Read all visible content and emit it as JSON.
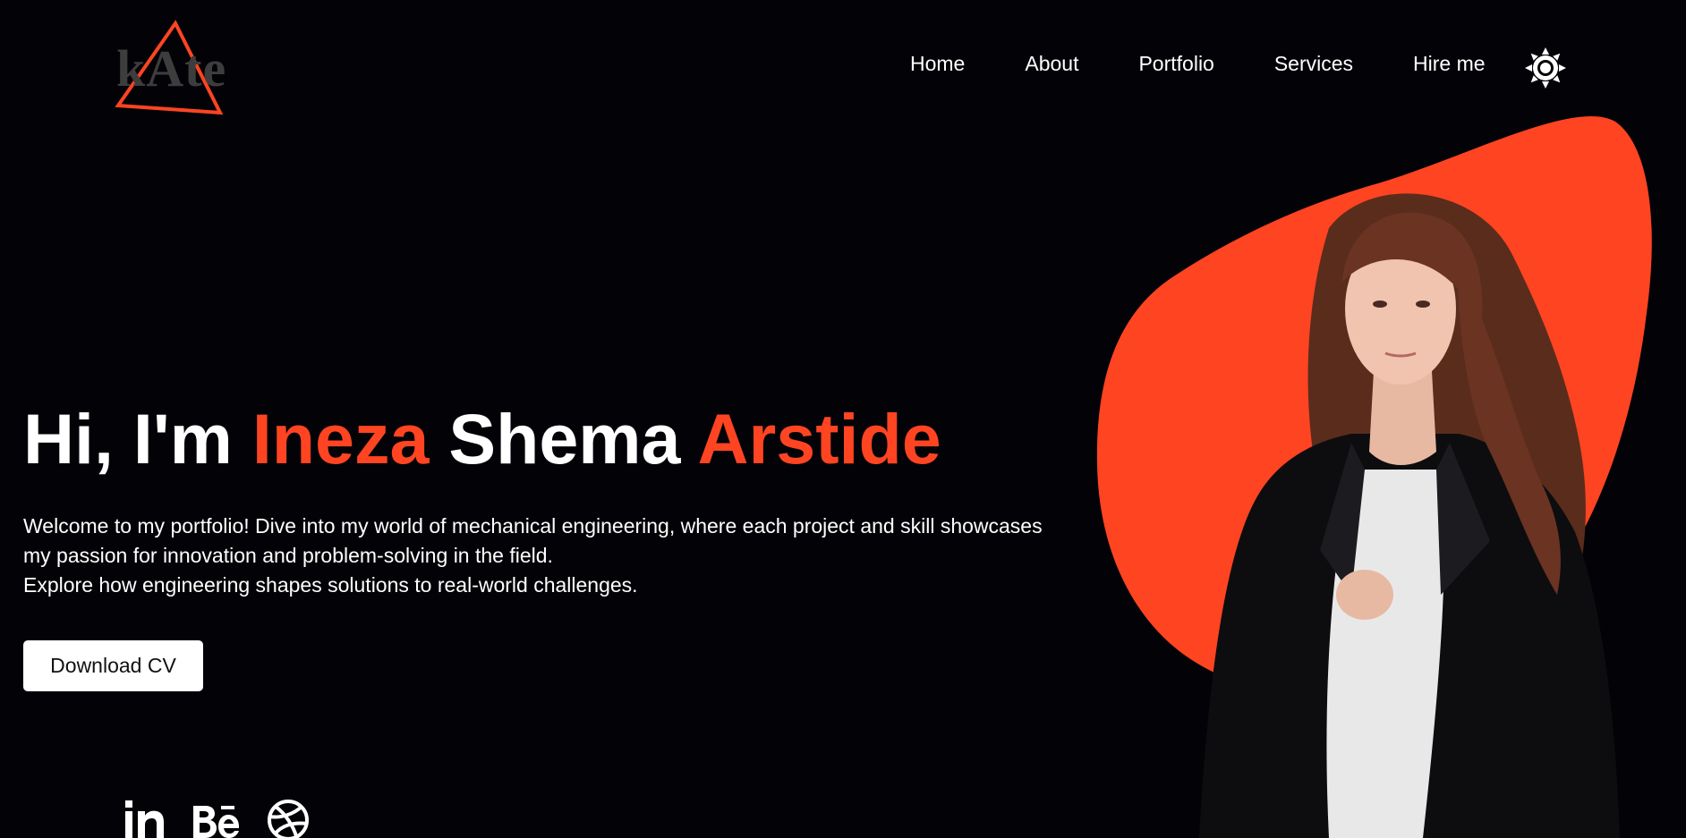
{
  "logo": {
    "text": "kAte",
    "accent_color": "#ff4422"
  },
  "nav": {
    "items": [
      {
        "label": "Home"
      },
      {
        "label": "About"
      },
      {
        "label": "Portfolio"
      },
      {
        "label": "Services"
      },
      {
        "label": "Hire me"
      }
    ],
    "theme_icon": "sun-icon"
  },
  "hero": {
    "greeting": "Hi, I'm",
    "name_first": "Ineza",
    "name_middle": "Shema",
    "name_last": "Arstide",
    "description_lines": [
      "Welcome to my portfolio! Dive into my world of mechanical engineering, where each project and skill showcases",
      "my passion for innovation and problem-solving in the field.",
      "Explore how engineering shapes solutions to real-world challenges."
    ],
    "cta_label": "Download CV"
  },
  "socials": [
    {
      "icon": "linkedin-icon",
      "glyph": "in"
    },
    {
      "icon": "behance-icon",
      "glyph": "Bē"
    },
    {
      "icon": "dribbble-icon"
    }
  ],
  "colors": {
    "background": "#030307",
    "accent": "#ff4422",
    "text": "#ffffff"
  }
}
